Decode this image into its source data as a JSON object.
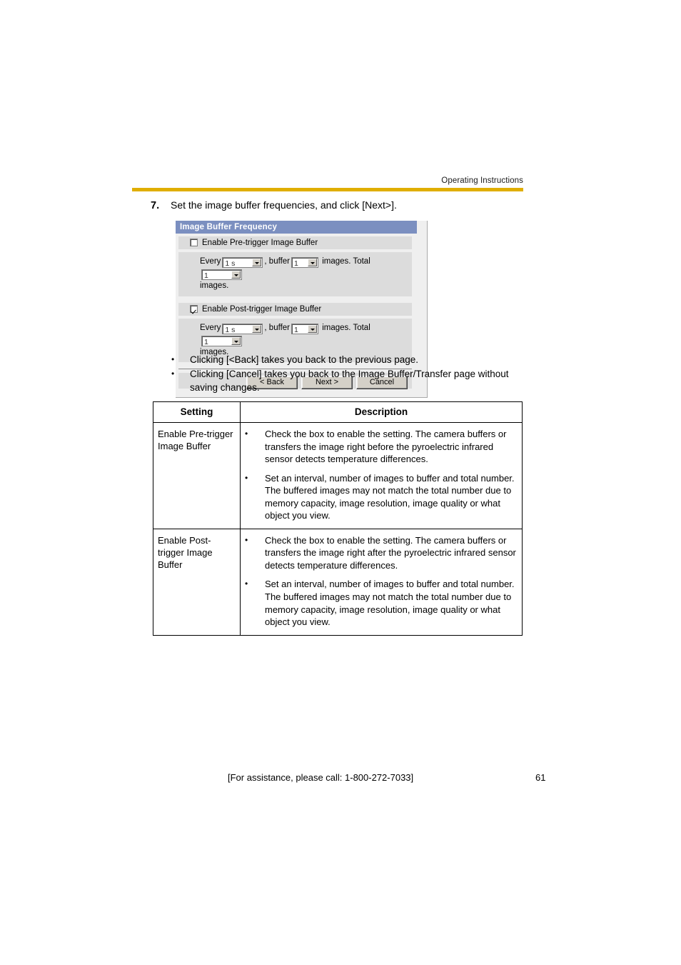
{
  "header": {
    "label": "Operating Instructions",
    "rule_color": "#e0ae00"
  },
  "step": {
    "number": "7.",
    "text": "Set the image buffer frequencies, and click [Next>]."
  },
  "dialog": {
    "title": "Image Buffer Frequency",
    "title_bg": "#7b8fc0",
    "pre_trigger": {
      "checkbox_label": "Enable Pre-trigger Image Buffer",
      "checked": false,
      "every_prefix": "Every",
      "every_value": "1 s",
      "buffer_prefix": ", buffer",
      "buffer_value": "1",
      "images_mid": "images. Total",
      "total_value": "1",
      "images_suffix": "images."
    },
    "post_trigger": {
      "checkbox_label": "Enable Post-trigger Image Buffer",
      "checked": true,
      "every_prefix": "Every",
      "every_value": "1 s",
      "buffer_prefix": ", buffer",
      "buffer_value": "1",
      "images_mid": "images. Total",
      "total_value": "1",
      "images_suffix": "images."
    },
    "buttons": {
      "back": "< Back",
      "next": "Next >",
      "cancel": "Cancel"
    }
  },
  "notes": {
    "bullet": "•",
    "items": [
      "Clicking [<Back] takes you back to the previous page.",
      "Clicking [Cancel] takes you back to the Image Buffer/Transfer page without saving changes."
    ]
  },
  "table": {
    "headers": {
      "setting": "Setting",
      "description": "Description"
    },
    "bullet": "•",
    "rows": [
      {
        "setting": "Enable Pre-trigger Image Buffer",
        "descriptions": [
          "Check the box to enable the setting. The camera buffers or transfers the image right before the pyroelectric infrared sensor detects temperature differences.",
          "Set an interval, number of images to buffer and total number. The buffered images may not match the total number due to memory capacity, image resolution, image quality or what object you view."
        ]
      },
      {
        "setting": "Enable Post-trigger Image Buffer",
        "descriptions": [
          "Check the box to enable the setting. The camera buffers or transfers the image right after the pyroelectric infrared sensor detects temperature differences.",
          "Set an interval, number of images to buffer and total number. The buffered images may not match the total number due to memory capacity, image resolution, image quality or what object you view."
        ]
      }
    ]
  },
  "footer": {
    "assistance": "[For assistance, please call: 1-800-272-7033]",
    "page_number": "61"
  }
}
